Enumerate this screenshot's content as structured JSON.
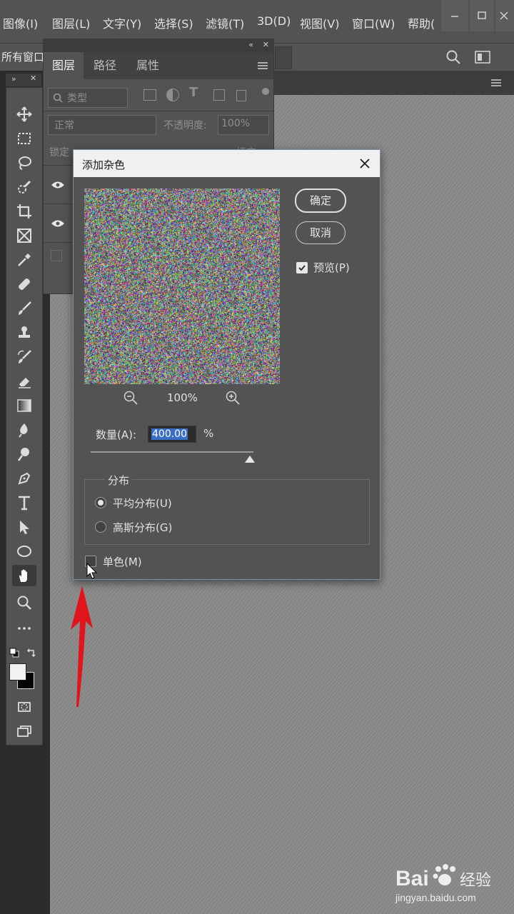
{
  "menubar": {
    "items": [
      "图像(I)",
      "图层(L)",
      "文字(Y)",
      "选择(S)",
      "滤镜(T)",
      "3D(D)",
      "视图(V)",
      "窗口(W)",
      "帮助("
    ]
  },
  "optionsbar": {
    "label": "所有窗口"
  },
  "layers_panel": {
    "tabs": [
      "图层",
      "路径",
      "属性"
    ],
    "filter_placeholder": "类型",
    "blend_mode": "正常",
    "opacity_label": "不透明度:",
    "opacity_value": "100%",
    "lock_label": "锁定",
    "fill_label": "填充"
  },
  "dialog": {
    "title": "添加杂色",
    "ok_label": "确定",
    "cancel_label": "取消",
    "preview_label": "预览(P)",
    "preview_checked": true,
    "zoom_level": "100%",
    "amount_label": "数量(A):",
    "amount_value": "400.00",
    "amount_unit": "%",
    "amount_fraction": 0.98,
    "distribution_label": "分布",
    "uniform_label": "平均分布(U)",
    "gaussian_label": "高斯分布(G)",
    "selected_distribution": "uniform",
    "mono_label": "单色(M)",
    "mono_checked": false
  },
  "watermark": {
    "brand": "Bai",
    "brand_cn": "经验",
    "url": "jingyan.baidu.com"
  },
  "colors": {
    "ui_panel": "#535353",
    "canvas_noise": "#8a8a8a",
    "annotation_arrow": "#e0141b",
    "selection": "#3b6fc7"
  },
  "icons": [
    "move-icon",
    "marquee-icon",
    "lasso-icon",
    "quick-select-icon",
    "crop-icon",
    "frame-icon",
    "eyedropper-icon",
    "healing-icon",
    "brush-icon",
    "stamp-icon",
    "history-brush-icon",
    "eraser-icon",
    "gradient-icon",
    "blur-icon",
    "dodge-icon",
    "pen-icon",
    "type-icon",
    "path-select-icon",
    "ellipse-icon",
    "hand-icon",
    "zoom-icon",
    "more-icon"
  ]
}
